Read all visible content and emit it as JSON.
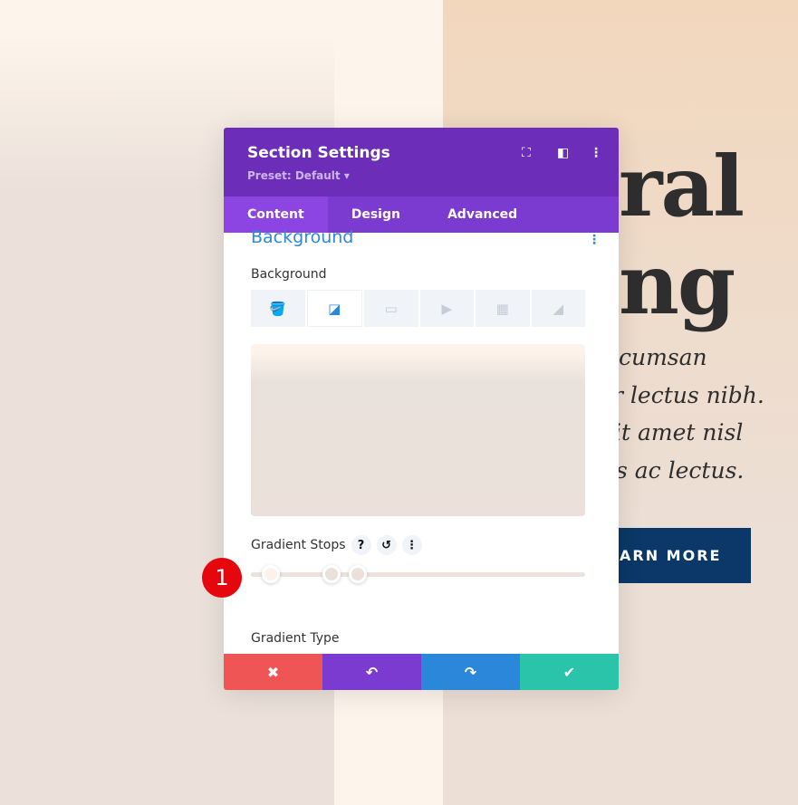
{
  "page": {
    "heading_line1": "ral",
    "heading_line2": "ng",
    "paragraph_lines": [
      "cumsan",
      "r lectus nibh.",
      "it amet nisl",
      "s ac lectus."
    ],
    "cta_label": "ARN MORE"
  },
  "modal": {
    "title": "Section Settings",
    "preset": "Preset: Default ▾",
    "header_icons": [
      "fullscreen-icon",
      "split-view-icon",
      "more-icon"
    ],
    "tabs": [
      {
        "label": "Content",
        "active": true
      },
      {
        "label": "Design"
      },
      {
        "label": "Advanced"
      }
    ],
    "section_title": "Background",
    "background_label": "Background",
    "background_types": [
      "color",
      "gradient",
      "image",
      "video",
      "pattern",
      "mask"
    ],
    "selected_background_type": "gradient",
    "gradient_stops_label": "Gradient Stops",
    "gradient_stops": [
      {
        "position_pct": 6,
        "color": "#fdf3ea"
      },
      {
        "position_pct": 24,
        "color": "#e9e1dc"
      },
      {
        "position_pct": 32,
        "color": "#ebe1da"
      }
    ],
    "gradient_type_label": "Gradient Type",
    "footer": {
      "cancel": "✖",
      "undo": "↶",
      "redo": "↷",
      "save": "✔"
    }
  },
  "annotation": {
    "badge": "1"
  },
  "colors": {
    "header": "#6c2eb9",
    "tabs": "#7b3ad0",
    "cancel": "#ef5555",
    "undo": "#7b3ad0",
    "redo": "#2b87da",
    "save": "#29c4a9",
    "cta": "#0b3868"
  }
}
